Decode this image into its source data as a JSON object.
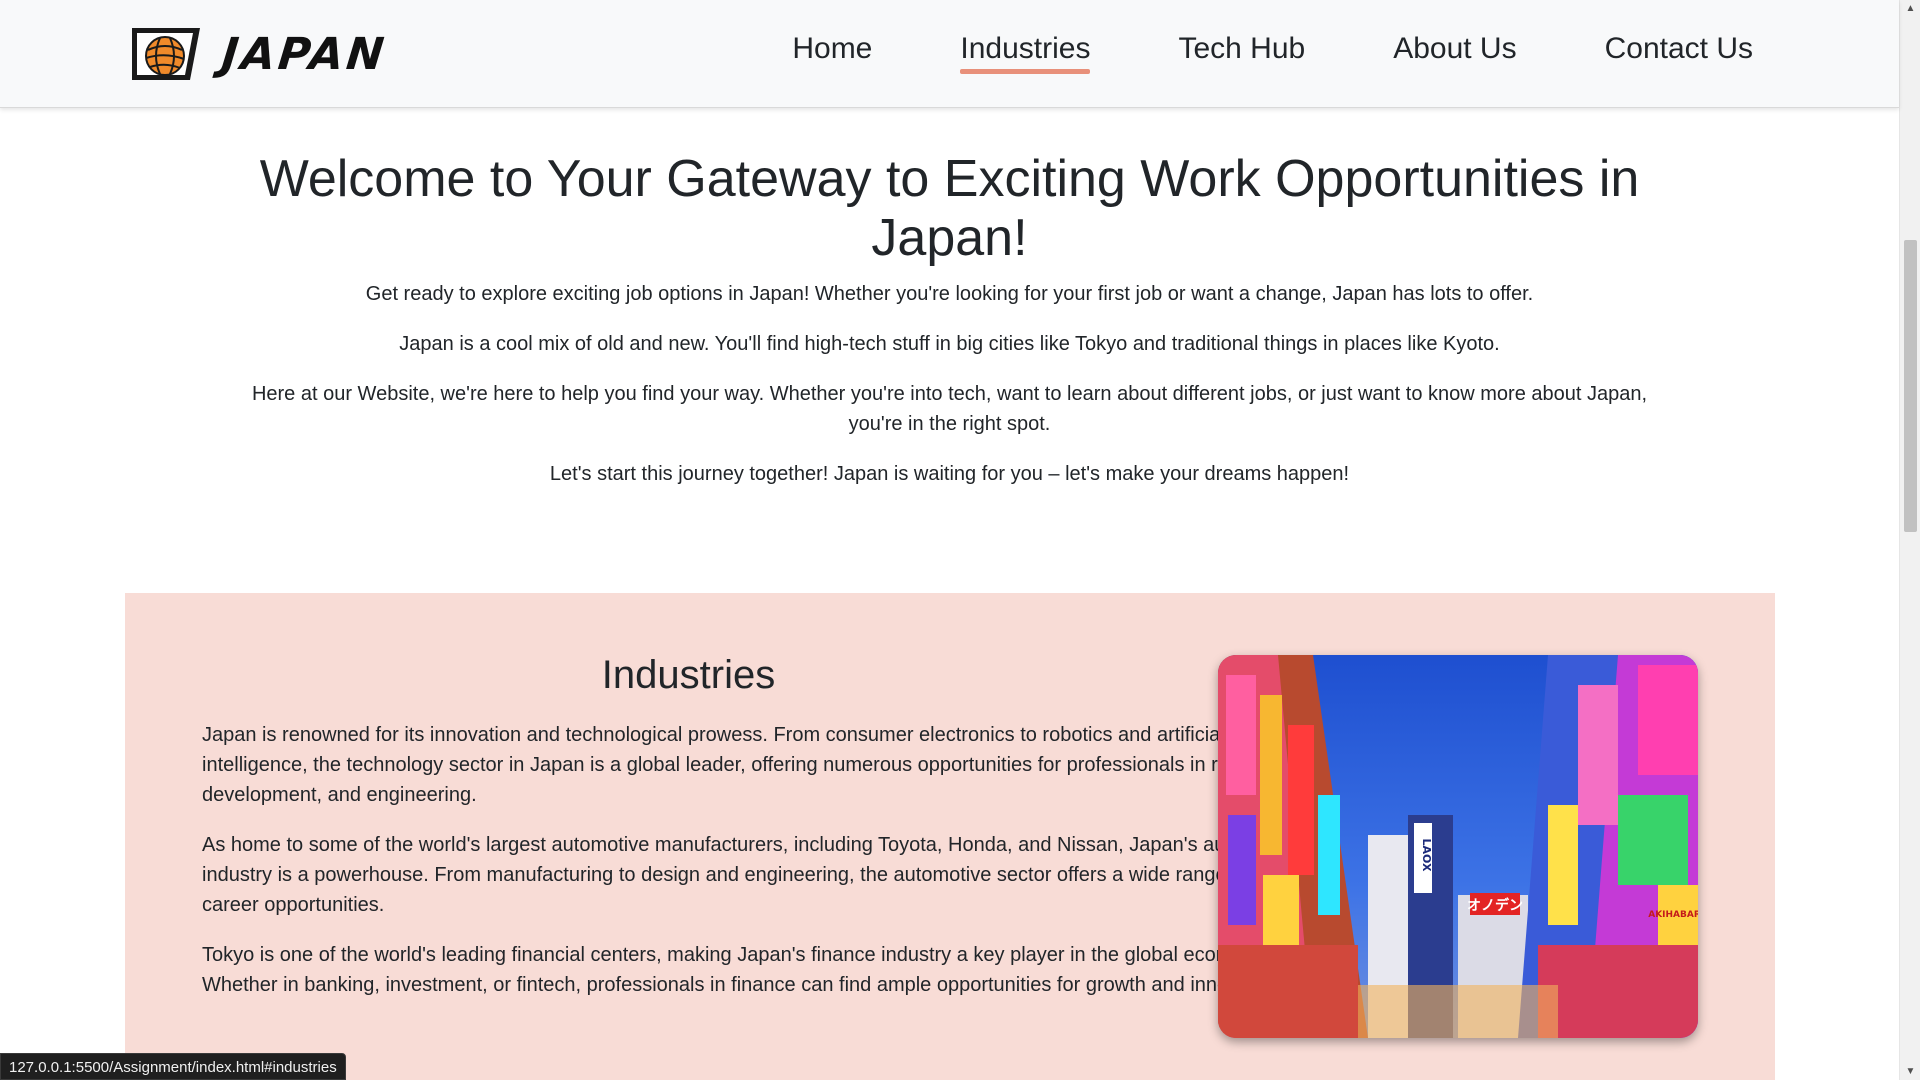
{
  "brand": {
    "name": "JAPAN",
    "logo_icon": "japan-globe-logo"
  },
  "nav": {
    "items": [
      {
        "label": "Home",
        "active": false
      },
      {
        "label": "Industries",
        "active": true
      },
      {
        "label": "Tech Hub",
        "active": false
      },
      {
        "label": "About Us",
        "active": false
      },
      {
        "label": "Contact Us",
        "active": false
      }
    ],
    "active_underline_color": "#e8907a"
  },
  "hero": {
    "title": "Welcome to Your Gateway to Exciting Work Opportunities in Japan!",
    "paragraphs": [
      "Get ready to explore exciting job options in Japan! Whether you're looking for your first job or want a change, Japan has lots to offer.",
      "Japan is a cool mix of old and new. You'll find high-tech stuff in big cities like Tokyo and traditional things in places like Kyoto.",
      "Here at our Website, we're here to help you find your way. Whether you're into tech, want to learn about different jobs, or just want to know more about Japan, you're in the right spot.",
      "Let's start this journey together! Japan is waiting for you – let's make your dreams happen!"
    ]
  },
  "industries": {
    "heading": "Industries",
    "background_color": "#f8dcd6",
    "paragraphs": [
      "Japan is renowned for its innovation and technological prowess. From consumer electronics to robotics and artificial intelligence, the technology sector in Japan is a global leader, offering numerous opportunities for professionals in research, development, and engineering.",
      "As home to some of the world's largest automotive manufacturers, including Toyota, Honda, and Nissan, Japan's automotive industry is a powerhouse. From manufacturing to design and engineering, the automotive sector offers a wide range of career opportunities.",
      "Tokyo is one of the world's leading financial centers, making Japan's finance industry a key player in the global economy. Whether in banking, investment, or fintech, professionals in finance can find ample opportunities for growth and innovation."
    ],
    "image_signs": [
      "LAOX",
      "オノデン",
      "AKIHABARA"
    ]
  },
  "status_bar": {
    "url": "127.0.0.1:5500/Assignment/index.html#industries"
  }
}
